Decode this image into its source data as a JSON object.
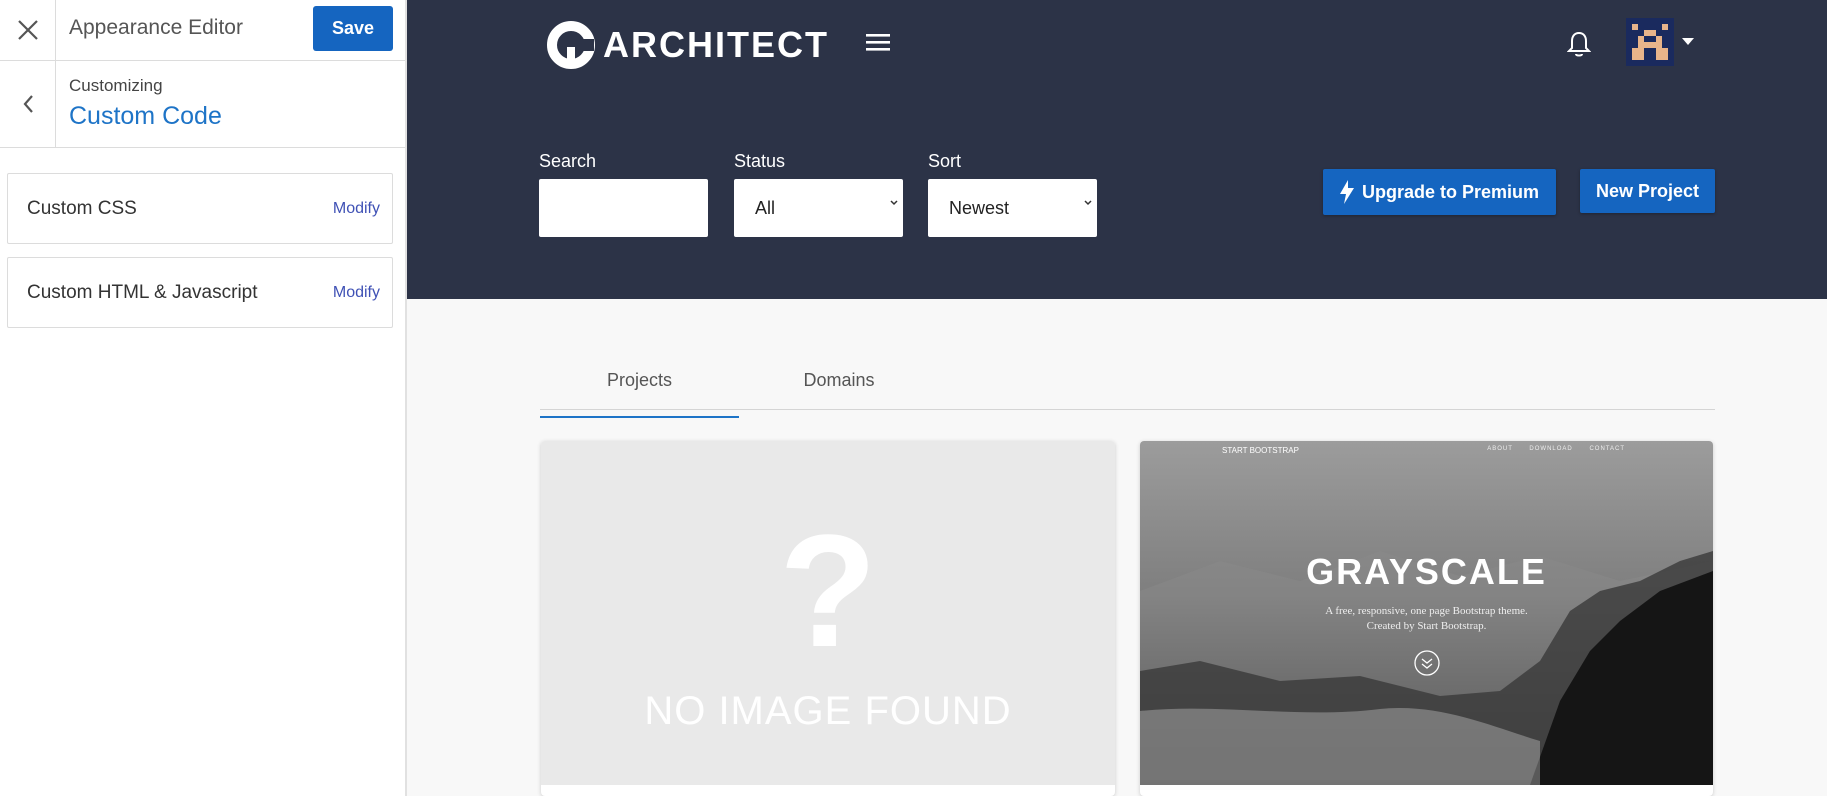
{
  "editor": {
    "title": "Appearance Editor",
    "save_label": "Save",
    "crumb_label": "Customizing",
    "crumb_value": "Custom Code",
    "sections": [
      {
        "label": "Custom CSS",
        "action": "Modify"
      },
      {
        "label": "Custom HTML & Javascript",
        "action": "Modify"
      }
    ]
  },
  "header": {
    "brand": "ARCHITECT",
    "search_label": "Search",
    "search_value": "",
    "status_label": "Status",
    "status_value": "All",
    "sort_label": "Sort",
    "sort_value": "Newest",
    "premium_label": "Upgrade to Premium",
    "new_project_label": "New Project"
  },
  "tabs": [
    {
      "label": "Projects",
      "active": true
    },
    {
      "label": "Domains",
      "active": false
    }
  ],
  "cards": [
    {
      "placeholder_text": "NO IMAGE FOUND"
    },
    {
      "brand": "START BOOTSTRAP",
      "nav": [
        "ABOUT",
        "DOWNLOAD",
        "CONTACT"
      ],
      "title": "GRAYSCALE",
      "subtitle_1": "A free, responsive, one page Bootstrap theme.",
      "subtitle_2": "Created by Start Bootstrap."
    }
  ],
  "colors": {
    "header_bg": "#2c3347",
    "primary": "#1565c0",
    "link": "#1e74c7",
    "modify_link": "#3f51b5"
  }
}
